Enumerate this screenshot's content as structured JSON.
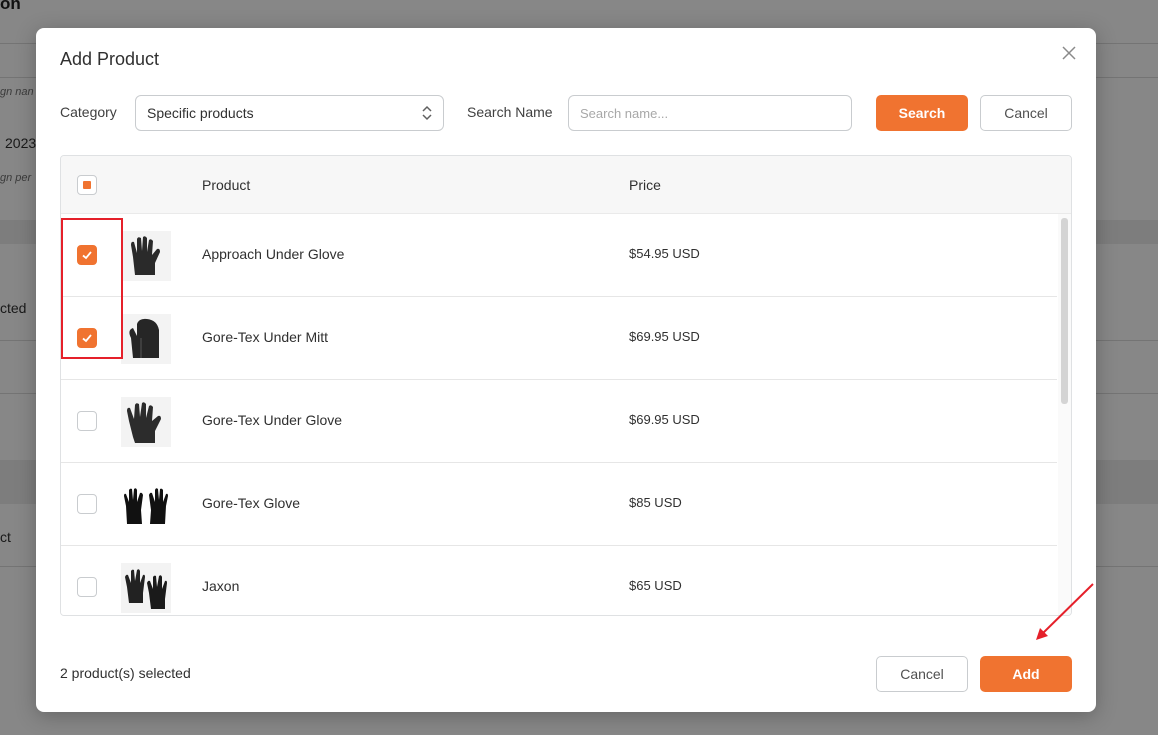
{
  "background": {
    "title": "on",
    "italic_1": "gn nan",
    "year": "2023",
    "italic_2": "gn per",
    "selected": "cted",
    "product": "ct"
  },
  "modal": {
    "title": "Add Product",
    "category_label": "Category",
    "category_value": "Specific products",
    "search_label": "Search Name",
    "search_placeholder": "Search name...",
    "search_value": "",
    "search_button": "Search",
    "cancel_top_button": "Cancel",
    "table": {
      "columns": [
        "Product",
        "Price"
      ],
      "rows": [
        {
          "name": "Approach Under Glove",
          "price": "$54.95 USD",
          "checked": true
        },
        {
          "name": "Gore-Tex Under Mitt",
          "price": "$69.95 USD",
          "checked": true
        },
        {
          "name": "Gore-Tex Under Glove",
          "price": "$69.95 USD",
          "checked": false
        },
        {
          "name": "Gore-Tex Glove",
          "price": "$85 USD",
          "checked": false
        },
        {
          "name": "Jaxon",
          "price": "$65 USD",
          "checked": false
        }
      ]
    },
    "footer": {
      "selected_text": "2 product(s) selected",
      "cancel_button": "Cancel",
      "add_button": "Add"
    }
  },
  "colors": {
    "accent": "#f07330",
    "annotation": "#e5202a"
  }
}
